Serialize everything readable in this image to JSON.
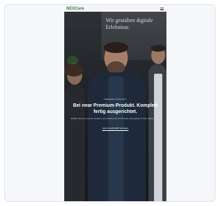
{
  "header": {
    "logo_text": "NEXCare"
  },
  "hero": {
    "headline": "Wir gestalten digitale Erlebnisse.",
    "eyebrow": "PREMIUM PRODUKT",
    "title": "Bei near Premium-Produkt. Komplett fertig ausgerichtet.",
    "subtitle": "Wählen Sie eine unserer Designs und erhalten Sie ein Produkt, das perfekt zu Ihrer Marke passt.",
    "cta_label": "Jetzt unverbindlich anfragen"
  },
  "colors": {
    "card_bg": "#f5f7fa",
    "card_border": "#dde3ea",
    "phone_bg": "#1d2024",
    "logo": "#3a7a52"
  },
  "icons": [
    "menu-icon"
  ]
}
